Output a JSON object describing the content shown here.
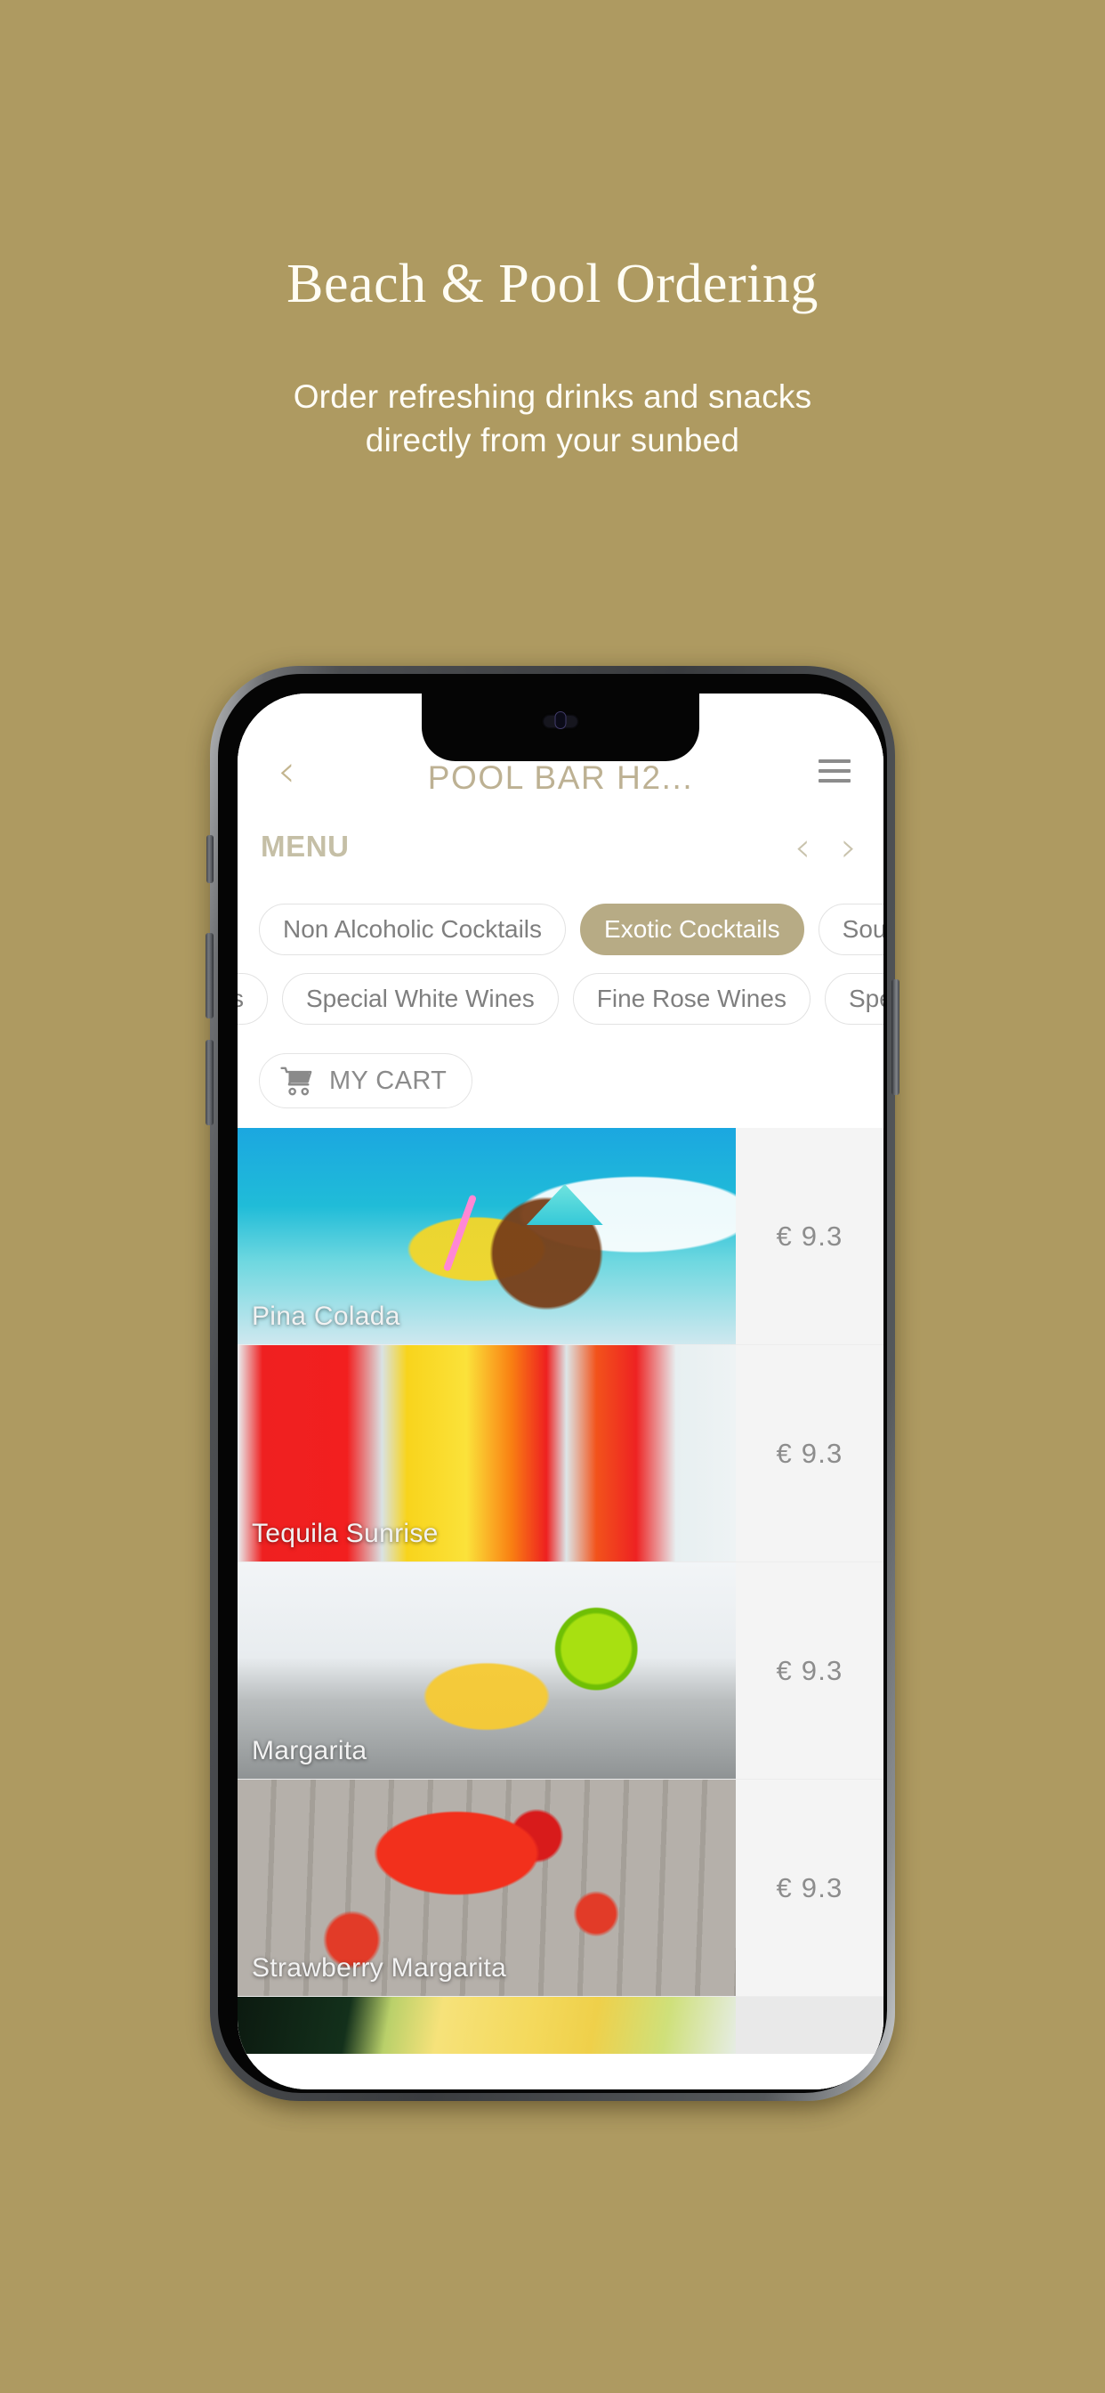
{
  "hero": {
    "title": "Beach & Pool Ordering",
    "subtitle_line1": "Order refreshing drinks and snacks",
    "subtitle_line2": "directly from your sunbed",
    "background_color": "#ae9a61",
    "title_color": "#fffdf4"
  },
  "app": {
    "header": {
      "back_icon": "chevron-left-icon",
      "title": "POOL BAR H2...",
      "menu_icon": "hamburger-menu-icon",
      "title_color": "#bdb193"
    },
    "menu_bar": {
      "label": "MENU",
      "prev_arrow": "‹",
      "next_arrow": "›"
    },
    "categories": {
      "accent_color": "#b7ab85",
      "row1": [
        {
          "label": "Non Alcoholic Cocktails",
          "active": false
        },
        {
          "label": "Exotic Cocktails",
          "active": true
        },
        {
          "label": "Sou",
          "active": false
        }
      ],
      "row2": [
        {
          "label": "s",
          "active": false
        },
        {
          "label": "Special White Wines",
          "active": false
        },
        {
          "label": "Fine Rose Wines",
          "active": false
        },
        {
          "label": "Spe",
          "active": false
        }
      ]
    },
    "cart": {
      "label": "MY CART",
      "icon": "shopping-cart-icon"
    },
    "products": [
      {
        "name": "Pina Colada",
        "price": "€ 9.3"
      },
      {
        "name": "Tequila Sunrise",
        "price": "€ 9.3"
      },
      {
        "name": "Margarita",
        "price": "€ 9.3"
      },
      {
        "name": "Strawberry Margarita",
        "price": "€ 9.3"
      },
      {
        "name": "",
        "price": ""
      }
    ]
  }
}
